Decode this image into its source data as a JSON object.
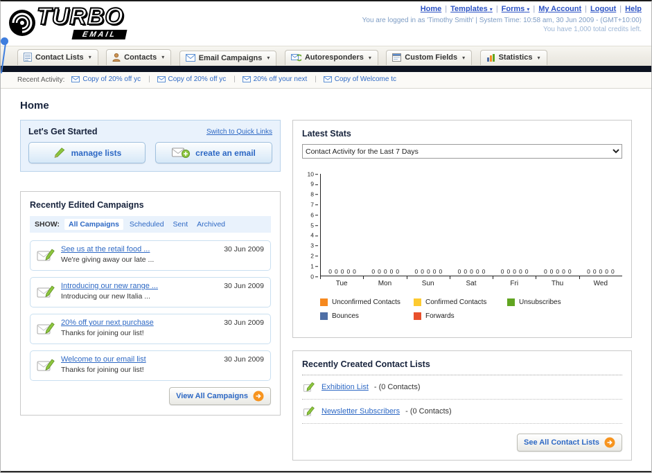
{
  "header": {
    "logo_title": "TURBO",
    "logo_subtitle": "EMAIL",
    "nav": {
      "home": "Home",
      "templates": "Templates",
      "forms": "Forms",
      "my_account": "My Account",
      "logout": "Logout",
      "help": "Help"
    },
    "login_line": "You are logged in as 'Timothy Smith' | System Time: 10:58 am, 30 Jun 2009 - (GMT+10:00)",
    "credits_line": "You have 1,000 total credits left."
  },
  "tabs": [
    {
      "label": "Contact Lists"
    },
    {
      "label": "Contacts"
    },
    {
      "label": "Email Campaigns"
    },
    {
      "label": "Autoresponders"
    },
    {
      "label": "Custom Fields"
    },
    {
      "label": "Statistics"
    }
  ],
  "activity": {
    "label": "Recent Activity:",
    "items": [
      "Copy of 20% off yc",
      "Copy of 20% off yc",
      "20% off your next",
      "Copy of Welcome tc"
    ]
  },
  "page_title": "Home",
  "get_started": {
    "title": "Let's Get Started",
    "switch_link": "Switch to Quick Links",
    "manage_lists_label": "manage lists",
    "create_email_label": "create an email"
  },
  "campaigns": {
    "title": "Recently Edited Campaigns",
    "show_label": "SHOW:",
    "filters": {
      "all": "All Campaigns",
      "scheduled": "Scheduled",
      "sent": "Sent",
      "archived": "Archived"
    },
    "items": [
      {
        "title": "See us at the retail food ...",
        "subtitle": "We're giving away our late ...",
        "date": "30 Jun 2009"
      },
      {
        "title": "Introducing our new range ...",
        "subtitle": "Introducing our new Italia ...",
        "date": "30 Jun 2009"
      },
      {
        "title": "20% off your next purchase",
        "subtitle": "Thanks for joining our list!",
        "date": "30 Jun 2009"
      },
      {
        "title": "Welcome to our email list",
        "subtitle": "Thanks for joining our list!",
        "date": "30 Jun 2009"
      }
    ],
    "view_all_label": "View All Campaigns"
  },
  "stats": {
    "title": "Latest Stats",
    "dropdown_value": "Contact Activity for the Last 7 Days"
  },
  "chart_data": {
    "type": "bar",
    "title": "Contact Activity for the Last 7 Days",
    "categories": [
      "Tue",
      "Mon",
      "Sun",
      "Sat",
      "Fri",
      "Thu",
      "Wed"
    ],
    "series": [
      {
        "name": "Unconfirmed Contacts",
        "color": "#f6891f",
        "values": [
          0,
          0,
          0,
          0,
          0,
          0,
          0
        ]
      },
      {
        "name": "Confirmed Contacts",
        "color": "#fdca30",
        "values": [
          0,
          0,
          0,
          0,
          0,
          0,
          0
        ]
      },
      {
        "name": "Unsubscribes",
        "color": "#61a521",
        "values": [
          0,
          0,
          0,
          0,
          0,
          0,
          0
        ]
      },
      {
        "name": "Bounces",
        "color": "#4f6fa6",
        "values": [
          0,
          0,
          0,
          0,
          0,
          0,
          0
        ]
      },
      {
        "name": "Forwards",
        "color": "#e8502c",
        "values": [
          0,
          0,
          0,
          0,
          0,
          0,
          0
        ]
      }
    ],
    "ylim": [
      0,
      10
    ],
    "yticks": [
      0,
      1,
      2,
      3,
      4,
      5,
      6,
      7,
      8,
      9,
      10
    ],
    "grid": false,
    "legend_position": "bottom"
  },
  "contact_lists": {
    "title": "Recently Created Contact Lists",
    "items": [
      {
        "name": "Exhibition List",
        "detail": "- (0 Contacts)"
      },
      {
        "name": "Newsletter Subscribers",
        "detail": "- (0 Contacts)"
      }
    ],
    "see_all_label": "See All Contact Lists"
  }
}
